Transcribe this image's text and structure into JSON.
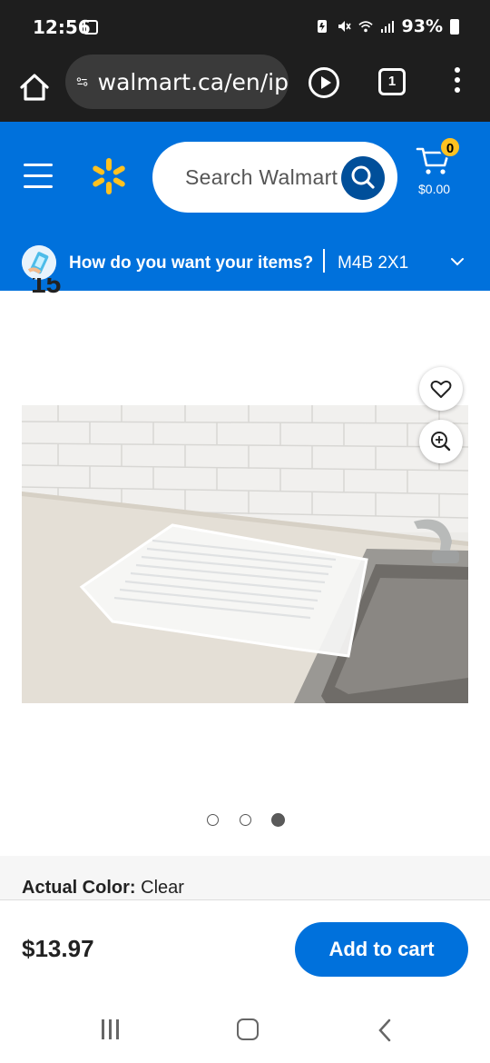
{
  "status_bar": {
    "time": "12:56",
    "battery": "93%"
  },
  "browser": {
    "url": "walmart.ca/en/ip",
    "tab_count": "1"
  },
  "header": {
    "search_placeholder": "Search Walmart",
    "cart_count": "0",
    "cart_total": "$0.00",
    "delivery_question": "How do you want your items?",
    "postal_code": "M4B 2X1",
    "brand_color": "#0071dc",
    "spark_color": "#ffc220"
  },
  "product": {
    "rating_peek": "15",
    "carousel": {
      "total": 3,
      "active_index": 2
    },
    "color_label": "Actual Color:",
    "color_value": "Clear",
    "price": "$13.97",
    "add_to_cart_label": "Add to cart"
  },
  "icons": {
    "home": "home-icon",
    "site_info": "tune-icon",
    "play": "play-circle-icon",
    "menu": "more-vertical-icon",
    "hamburger": "hamburger-menu-icon",
    "logo": "walmart-spark-icon",
    "search": "search-icon",
    "cart": "cart-icon",
    "favorite": "heart-icon",
    "zoom": "zoom-in-icon"
  }
}
